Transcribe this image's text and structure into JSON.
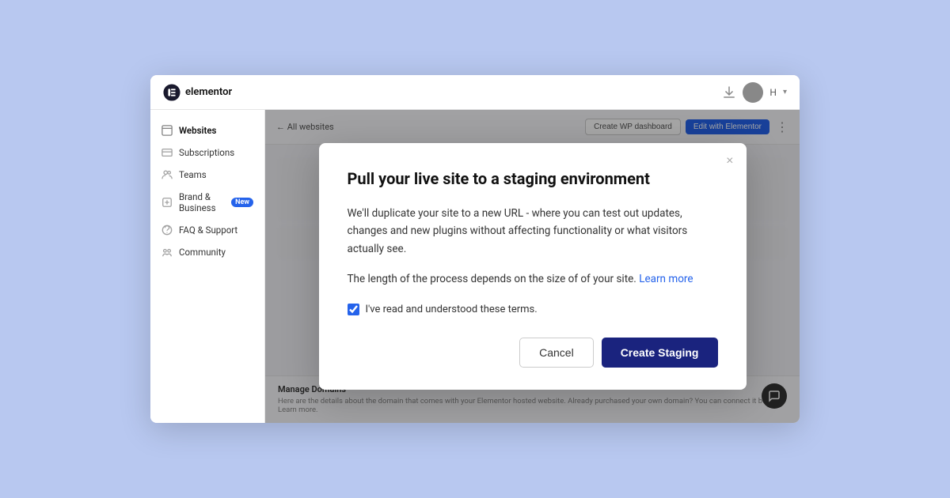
{
  "background_color": "#b8c8f0",
  "topbar": {
    "logo_text": "elementor",
    "user_initials": "H",
    "chevron": "▾"
  },
  "sidebar": {
    "items": [
      {
        "id": "websites",
        "label": "Websites",
        "active": true
      },
      {
        "id": "subscriptions",
        "label": "Subscriptions",
        "active": false
      },
      {
        "id": "teams",
        "label": "Teams",
        "active": false
      },
      {
        "id": "brand-business",
        "label": "Brand & Business",
        "active": false,
        "badge": "New"
      },
      {
        "id": "faq-support",
        "label": "FAQ & Support",
        "active": false
      },
      {
        "id": "community",
        "label": "Community",
        "active": false
      }
    ]
  },
  "content_header": {
    "back_label": "← All websites",
    "btn_wp_dashboard": "Create WP dashboard",
    "btn_edit": "Edit with Elementor",
    "dots": "⋮"
  },
  "bottom_section": {
    "title": "Manage Domains",
    "description": "Here are the details about the domain that comes with your Elementor hosted website. Already purchased your own domain? You can connect it below. Learn more."
  },
  "modal": {
    "title": "Pull your live site to a staging environment",
    "body_paragraph": "We'll duplicate your site to a new URL - where you can test out updates, changes and new plugins without affecting functionality or what visitors actually see.",
    "note_prefix": "The length of the process depends on the size of of your site.",
    "learn_more_label": "Learn more",
    "checkbox_label": "I've read and understood these terms.",
    "checkbox_checked": true,
    "cancel_label": "Cancel",
    "create_staging_label": "Create Staging",
    "close_icon": "×"
  }
}
